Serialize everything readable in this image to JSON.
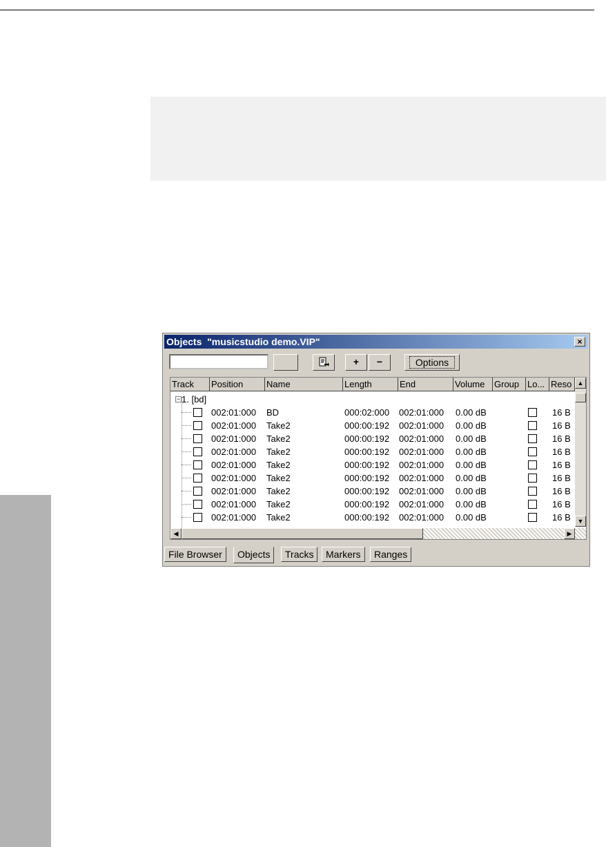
{
  "window": {
    "title": "Objects  \"musicstudio demo.VIP\"",
    "close_label": "×"
  },
  "toolbar": {
    "search_value": "",
    "plus_label": "+",
    "minus_label": "−",
    "options_label": "Options"
  },
  "columns": [
    "Track",
    "Position",
    "Name",
    "Length",
    "End",
    "Volume",
    "Group",
    "Lo...",
    "Reso"
  ],
  "tree": {
    "group_label": "1. [bd]",
    "rows": [
      {
        "position": "002:01:000",
        "name": "BD",
        "length": "000:02:000",
        "end": "002:01:000",
        "volume": "0.00 dB",
        "reso": "16 B"
      },
      {
        "position": "002:01:000",
        "name": "Take2",
        "length": "000:00:192",
        "end": "002:01:000",
        "volume": "0.00 dB",
        "reso": "16 B"
      },
      {
        "position": "002:01:000",
        "name": "Take2",
        "length": "000:00:192",
        "end": "002:01:000",
        "volume": "0.00 dB",
        "reso": "16 B"
      },
      {
        "position": "002:01:000",
        "name": "Take2",
        "length": "000:00:192",
        "end": "002:01:000",
        "volume": "0.00 dB",
        "reso": "16 B"
      },
      {
        "position": "002:01:000",
        "name": "Take2",
        "length": "000:00:192",
        "end": "002:01:000",
        "volume": "0.00 dB",
        "reso": "16 B"
      },
      {
        "position": "002:01:000",
        "name": "Take2",
        "length": "000:00:192",
        "end": "002:01:000",
        "volume": "0.00 dB",
        "reso": "16 B"
      },
      {
        "position": "002:01:000",
        "name": "Take2",
        "length": "000:00:192",
        "end": "002:01:000",
        "volume": "0.00 dB",
        "reso": "16 B"
      },
      {
        "position": "002:01:000",
        "name": "Take2",
        "length": "000:00:192",
        "end": "002:01:000",
        "volume": "0.00 dB",
        "reso": "16 B"
      },
      {
        "position": "002:01:000",
        "name": "Take2",
        "length": "000:00:192",
        "end": "002:01:000",
        "volume": "0.00 dB",
        "reso": "16 B"
      }
    ]
  },
  "tabs": [
    {
      "label": "File Browser",
      "active": false
    },
    {
      "label": "Objects",
      "active": true
    },
    {
      "label": "Tracks",
      "active": false
    },
    {
      "label": "Markers",
      "active": false
    },
    {
      "label": "Ranges",
      "active": false
    }
  ],
  "icons": {
    "export": "export-icon",
    "scroll_up": "scroll-up-arrow-icon",
    "scroll_down": "scroll-down-arrow-icon",
    "scroll_left": "scroll-left-arrow-icon",
    "scroll_right": "scroll-right-arrow-icon"
  }
}
